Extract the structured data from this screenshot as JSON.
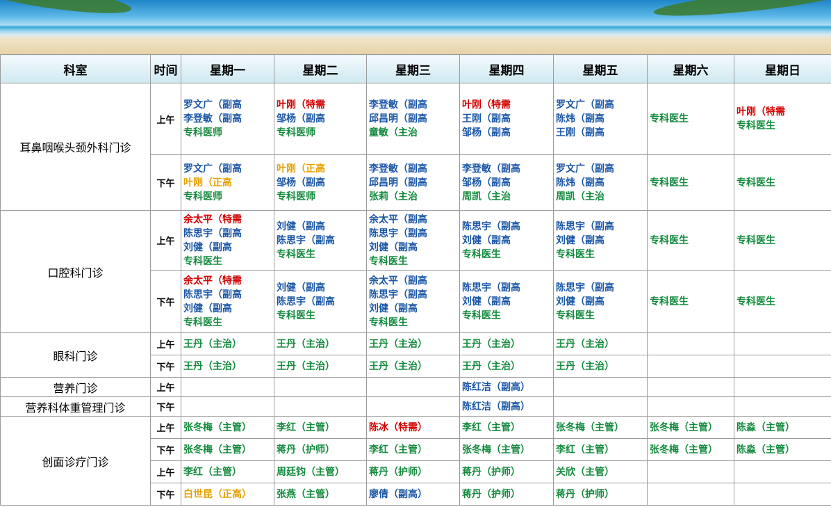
{
  "colors": {
    "blue": "#1a56a6",
    "green": "#138a3d",
    "red": "#d40000",
    "orange": "#e6a100",
    "header_bg": "#d6ecf4"
  },
  "headers": [
    "科室",
    "时间",
    "星期一",
    "星期二",
    "星期三",
    "星期四",
    "星期五",
    "星期六",
    "星期日"
  ],
  "rows": [
    {
      "dept": "耳鼻咽喉头颈外科门诊",
      "span": 2,
      "time": "上午",
      "cells": [
        [
          [
            "罗文广（副高",
            "blue"
          ],
          [
            "李登敏（副高",
            "blue"
          ],
          [
            "专科医师",
            "green"
          ]
        ],
        [
          [
            "叶刚（特需",
            "red"
          ],
          [
            "邹杨（副高",
            "blue"
          ],
          [
            "专科医师",
            "green"
          ]
        ],
        [
          [
            "李登敏（副高",
            "blue"
          ],
          [
            "邱昌明（副高",
            "blue"
          ],
          [
            "童敏（主治",
            "green"
          ]
        ],
        [
          [
            "叶刚（特需",
            "red"
          ],
          [
            "王刚（副高",
            "blue"
          ],
          [
            "邹杨（副高",
            "blue"
          ]
        ],
        [
          [
            "罗文广（副高",
            "blue"
          ],
          [
            "陈炜（副高",
            "blue"
          ],
          [
            "王刚（副高",
            "blue"
          ]
        ],
        [
          [
            "专科医生",
            "green"
          ]
        ],
        [
          [
            "叶刚（特需",
            "red"
          ],
          [
            "专科医生",
            "green"
          ]
        ]
      ]
    },
    {
      "time": "下午",
      "cells": [
        [
          [
            "罗文广（副高",
            "blue"
          ],
          [
            "叶刚（正高",
            "orange"
          ],
          [
            "专科医师",
            "green"
          ]
        ],
        [
          [
            "叶刚（正高",
            "orange"
          ],
          [
            "邹杨（副高",
            "blue"
          ],
          [
            "专科医师",
            "green"
          ]
        ],
        [
          [
            "李登敏（副高",
            "blue"
          ],
          [
            "邱昌明（副高",
            "blue"
          ],
          [
            "张莉（主治",
            "green"
          ]
        ],
        [
          [
            "李登敏（副高",
            "blue"
          ],
          [
            "邹杨（副高",
            "blue"
          ],
          [
            "周凯（主治",
            "green"
          ]
        ],
        [
          [
            "罗文广（副高",
            "blue"
          ],
          [
            "陈炜（副高",
            "blue"
          ],
          [
            "周凯（主治",
            "green"
          ]
        ],
        [
          [
            "专科医生",
            "green"
          ]
        ],
        [
          [
            "专科医生",
            "green"
          ]
        ]
      ]
    },
    {
      "dept": "口腔科门诊",
      "span": 2,
      "time": "上午",
      "cells": [
        [
          [
            "余太平（特需",
            "red"
          ],
          [
            "陈思宇（副高",
            "blue"
          ],
          [
            "刘健（副高",
            "blue"
          ],
          [
            "专科医生",
            "green"
          ]
        ],
        [
          [
            "刘健（副高",
            "blue"
          ],
          [
            "陈思宇（副高",
            "blue"
          ],
          [
            "专科医生",
            "green"
          ]
        ],
        [
          [
            "余太平（副高",
            "blue"
          ],
          [
            "陈思宇（副高",
            "blue"
          ],
          [
            "刘健（副高",
            "blue"
          ],
          [
            "专科医生",
            "green"
          ]
        ],
        [
          [
            "陈思宇（副高",
            "blue"
          ],
          [
            "刘健（副高",
            "blue"
          ],
          [
            "专科医生",
            "green"
          ]
        ],
        [
          [
            "陈思宇（副高",
            "blue"
          ],
          [
            "刘健（副高",
            "blue"
          ],
          [
            "专科医生",
            "green"
          ]
        ],
        [
          [
            "专科医生",
            "green"
          ]
        ],
        [
          [
            "专科医生",
            "green"
          ]
        ]
      ]
    },
    {
      "time": "下午",
      "cells": [
        [
          [
            "余太平（特需",
            "red"
          ],
          [
            "陈思宇（副高",
            "blue"
          ],
          [
            "刘健（副高",
            "blue"
          ],
          [
            "专科医生",
            "green"
          ]
        ],
        [
          [
            "刘健（副高",
            "blue"
          ],
          [
            "陈思宇（副高",
            "blue"
          ],
          [
            "专科医生",
            "green"
          ]
        ],
        [
          [
            "余太平（副高",
            "blue"
          ],
          [
            "陈思宇（副高",
            "blue"
          ],
          [
            "刘健（副高",
            "blue"
          ],
          [
            "专科医生",
            "green"
          ]
        ],
        [
          [
            "陈思宇（副高",
            "blue"
          ],
          [
            "刘健（副高",
            "blue"
          ],
          [
            "专科医生",
            "green"
          ]
        ],
        [
          [
            "陈思宇（副高",
            "blue"
          ],
          [
            "刘健（副高",
            "blue"
          ],
          [
            "专科医生",
            "green"
          ]
        ],
        [
          [
            "专科医生",
            "green"
          ]
        ],
        [
          [
            "专科医生",
            "green"
          ]
        ]
      ]
    },
    {
      "dept": "眼科门诊",
      "span": 2,
      "time": "上午",
      "cells": [
        [
          [
            "王丹（主治）",
            "green"
          ]
        ],
        [
          [
            "王丹（主治）",
            "green"
          ]
        ],
        [
          [
            "王丹（主治）",
            "green"
          ]
        ],
        [
          [
            "王丹（主治）",
            "green"
          ]
        ],
        [
          [
            "王丹（主治）",
            "green"
          ]
        ],
        [],
        []
      ]
    },
    {
      "time": "下午",
      "cells": [
        [
          [
            "王丹（主治）",
            "green"
          ]
        ],
        [
          [
            "王丹（主治）",
            "green"
          ]
        ],
        [
          [
            "王丹（主治）",
            "green"
          ]
        ],
        [
          [
            "王丹（主治）",
            "green"
          ]
        ],
        [
          [
            "王丹（主治）",
            "green"
          ]
        ],
        [],
        []
      ]
    },
    {
      "dept": "营养门诊",
      "span": 1,
      "time": "上午",
      "cells": [
        [],
        [],
        [],
        [
          [
            "陈红洁（副高）",
            "blue"
          ]
        ],
        [],
        [],
        []
      ]
    },
    {
      "dept": "营养科体重管理门诊",
      "span": 1,
      "time": "下午",
      "cells": [
        [],
        [],
        [],
        [
          [
            "陈红洁（副高）",
            "blue"
          ]
        ],
        [],
        [],
        []
      ]
    },
    {
      "dept": "创面诊疗门诊",
      "span": 4,
      "time": "上午",
      "cells": [
        [
          [
            "张冬梅（主管）",
            "green"
          ]
        ],
        [
          [
            "李红（主管）",
            "green"
          ]
        ],
        [
          [
            "陈冰（特需）",
            "red"
          ]
        ],
        [
          [
            "李红（主管）",
            "green"
          ]
        ],
        [
          [
            "张冬梅（主管）",
            "green"
          ]
        ],
        [
          [
            "张冬梅（主管）",
            "green"
          ]
        ],
        [
          [
            "陈淼（主管）",
            "green"
          ]
        ]
      ]
    },
    {
      "time": "下午",
      "cells": [
        [
          [
            "张冬梅（主管）",
            "green"
          ]
        ],
        [
          [
            "蒋丹（护师）",
            "green"
          ]
        ],
        [
          [
            "李红（主管）",
            "green"
          ]
        ],
        [
          [
            "张冬梅（主管）",
            "green"
          ]
        ],
        [
          [
            "李红（主管）",
            "green"
          ]
        ],
        [
          [
            "张冬梅（主管）",
            "green"
          ]
        ],
        [
          [
            "陈淼（主管）",
            "green"
          ]
        ]
      ]
    },
    {
      "time": "上午",
      "cells": [
        [
          [
            "李红（主管）",
            "green"
          ]
        ],
        [
          [
            "周廷钧（主管）",
            "green"
          ]
        ],
        [
          [
            "蒋丹（护师）",
            "green"
          ]
        ],
        [
          [
            "蒋丹（护师）",
            "green"
          ]
        ],
        [
          [
            "关欣（主管）",
            "green"
          ]
        ],
        [],
        []
      ]
    },
    {
      "time": "下午",
      "cells": [
        [
          [
            "白世昆（正高）",
            "orange"
          ]
        ],
        [
          [
            "张燕（主管）",
            "green"
          ]
        ],
        [
          [
            "廖倩（副高）",
            "blue"
          ]
        ],
        [
          [
            "蒋丹（护师）",
            "green"
          ]
        ],
        [
          [
            "蒋丹（护师）",
            "green"
          ]
        ],
        [],
        []
      ]
    }
  ]
}
